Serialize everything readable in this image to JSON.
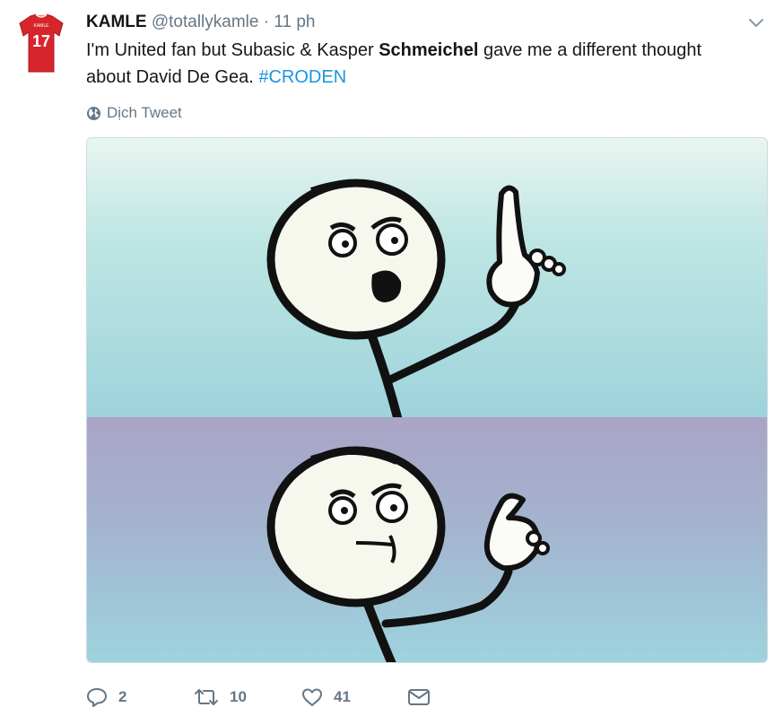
{
  "tweet": {
    "author_name": "KAMLE",
    "handle": "@totallykamle",
    "separator": "·",
    "time": "11 ph",
    "avatar_jersey_number": "17",
    "avatar_jersey_name": "KAMLE",
    "text_part1": "I'm United fan but Subasic & Kasper ",
    "text_bold": "Schmeichel",
    "text_part2": " gave me a different thought about David De Gea. ",
    "hashtag": "#CRODEN",
    "translate_label": "Dịch Tweet",
    "media": {
      "panels": [
        "pointing-finger-meme-top",
        "pointing-finger-meme-bottom"
      ]
    },
    "actions": {
      "reply_count": "2",
      "retweet_count": "10",
      "like_count": "41"
    }
  },
  "colors": {
    "link": "#1b95e0",
    "secondary_text": "#657786",
    "jersey_red": "#d8252b"
  },
  "icons": [
    "chevron-down-icon",
    "globe-icon",
    "reply-icon",
    "retweet-icon",
    "heart-icon",
    "message-icon"
  ]
}
